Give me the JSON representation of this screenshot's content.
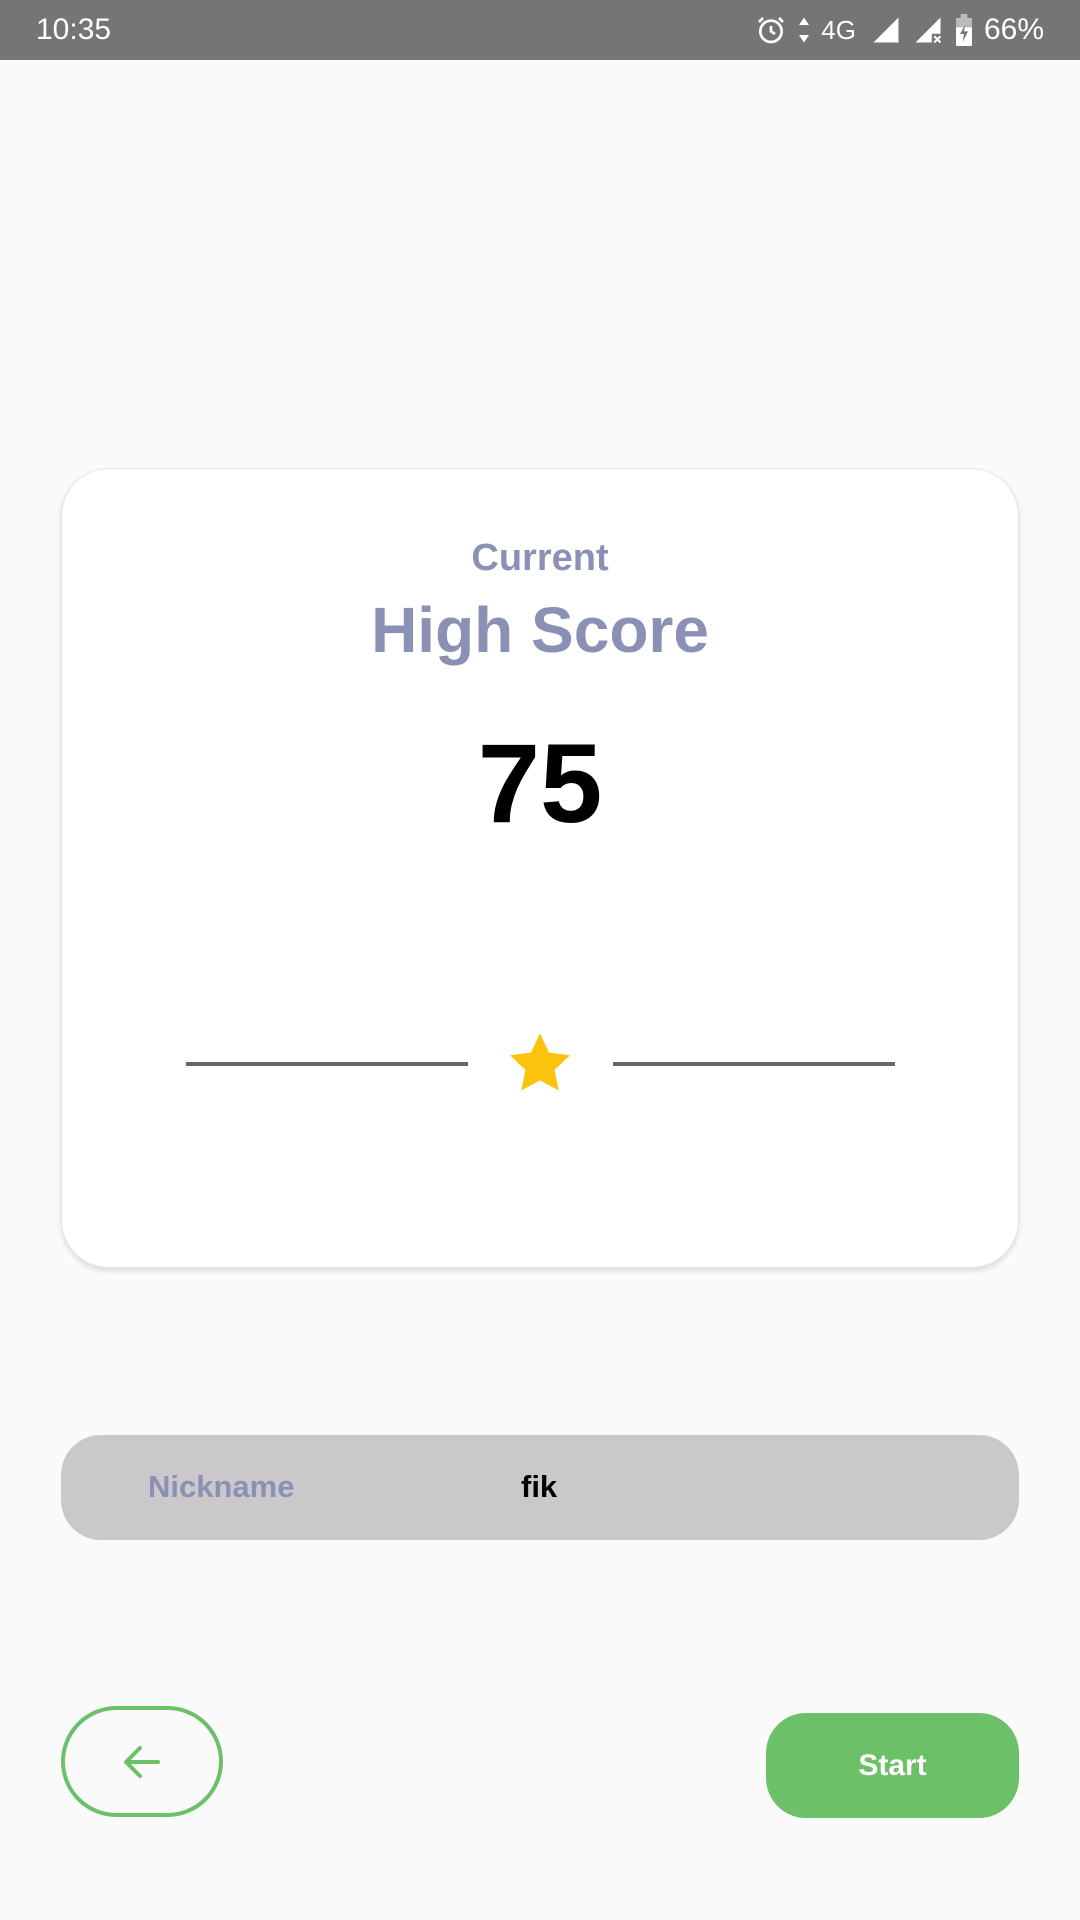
{
  "status_bar": {
    "time": "10:35",
    "network": "4G",
    "battery": "66%",
    "icons": [
      "alarm-icon",
      "data-arrows-icon",
      "signal-icon",
      "signal-no-data-icon",
      "battery-charging-icon"
    ]
  },
  "card": {
    "subtitle": "Current",
    "title": "High Score",
    "score": "75",
    "icon": "star-icon"
  },
  "nickname": {
    "label": "Nickname",
    "value": "fik"
  },
  "actions": {
    "back_icon": "arrow-left-icon",
    "start_label": "Start"
  },
  "colors": {
    "accent": "#6cc068",
    "label": "#8b90b5",
    "star": "#fcc30c",
    "status_bar": "#757575",
    "nickname_bg": "#cac8ca"
  }
}
